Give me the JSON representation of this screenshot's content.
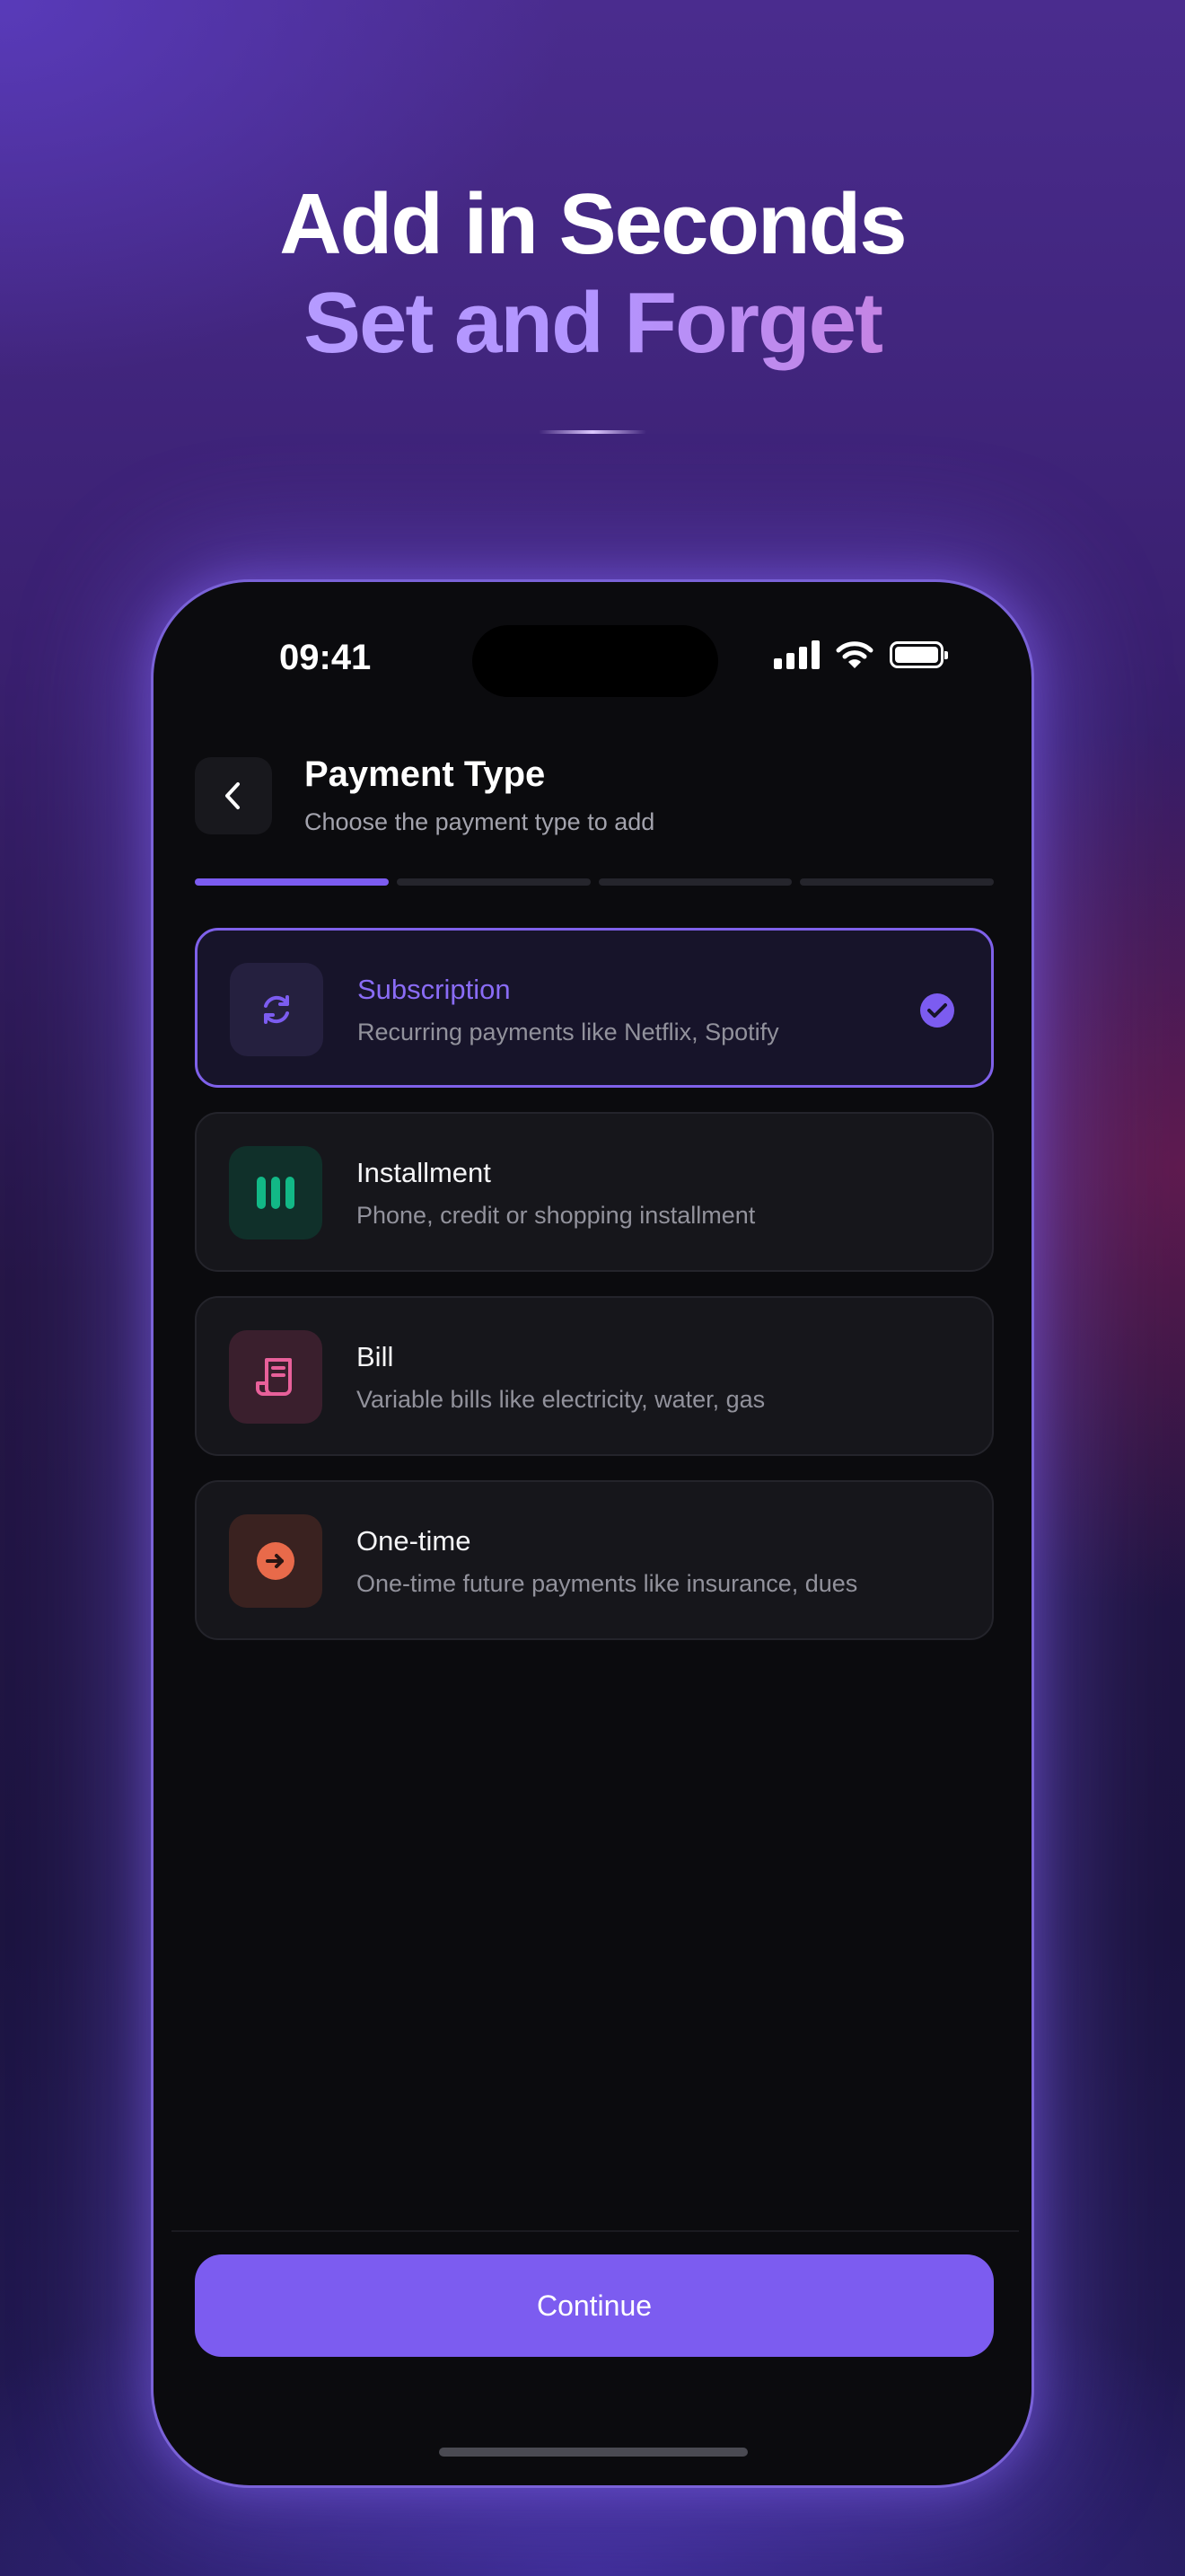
{
  "hero": {
    "line1": "Add in Seconds",
    "line2": "Set and Forget"
  },
  "status_bar": {
    "time": "09:41"
  },
  "header": {
    "back_icon": "chevron-left-icon",
    "title": "Payment Type",
    "subtitle": "Choose the payment type to add"
  },
  "progress": {
    "total_steps": 4,
    "current_step": 1
  },
  "options": [
    {
      "title": "Subscription",
      "description": "Recurring payments like Netflix, Spotify",
      "icon": "refresh-icon",
      "color": "#7c5cf0",
      "selected": true
    },
    {
      "title": "Installment",
      "description": "Phone, credit or shopping installment",
      "icon": "installment-bars-icon",
      "color": "#12b886",
      "selected": false
    },
    {
      "title": "Bill",
      "description": "Variable bills like electricity, water, gas",
      "icon": "receipt-icon",
      "color": "#e8609a",
      "selected": false
    },
    {
      "title": "One-time",
      "description": "One-time future payments like insurance, dues",
      "icon": "arrow-right-circle-icon",
      "color": "#e86a4a",
      "selected": false
    }
  ],
  "footer": {
    "continue_label": "Continue"
  },
  "colors": {
    "accent": "#7c5cf0",
    "background": "#0b0b0e",
    "card": "#16161b"
  }
}
